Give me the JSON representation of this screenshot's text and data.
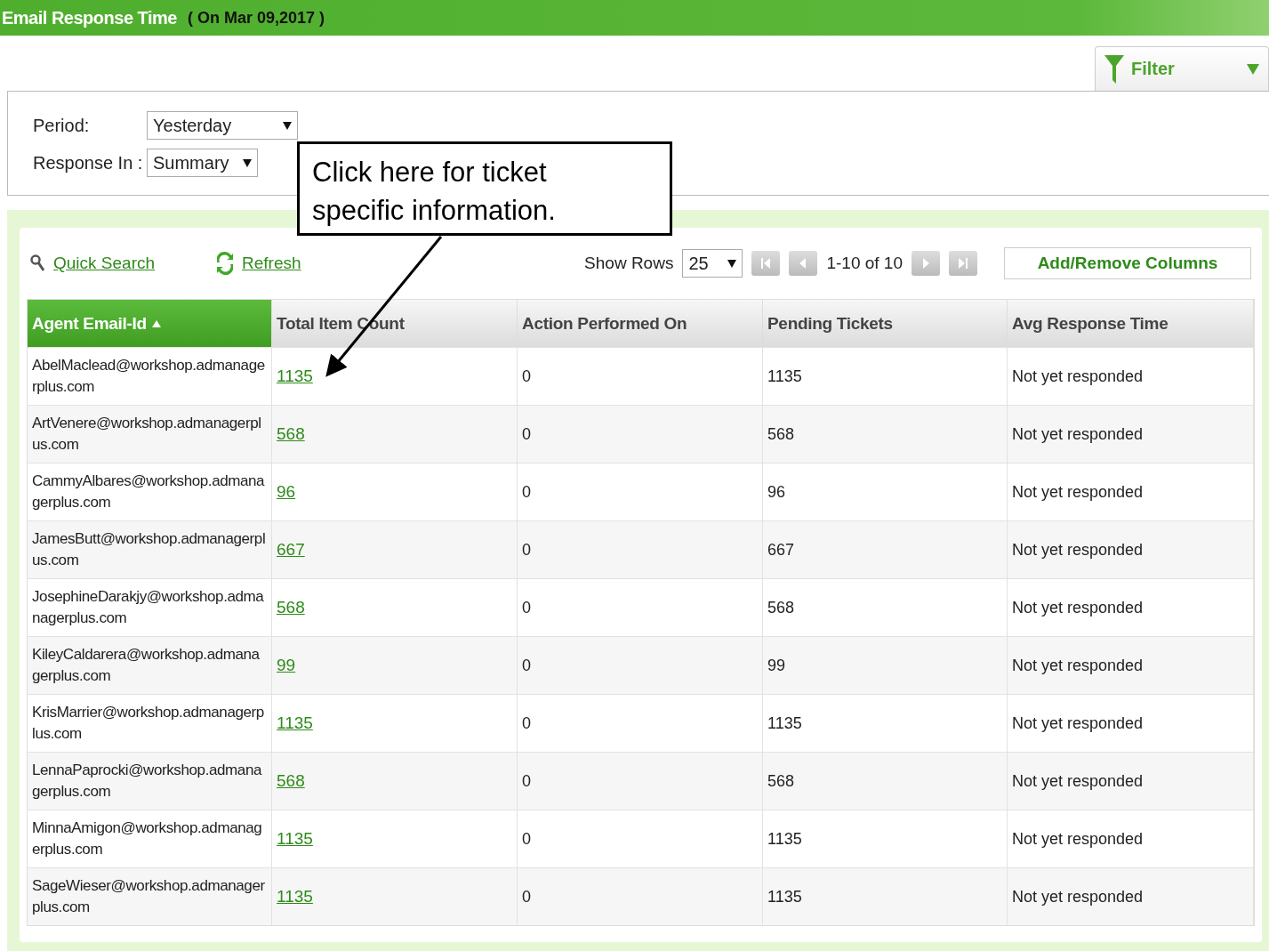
{
  "header": {
    "title": "Email Response Time",
    "date": "( On Mar 09,2017 )"
  },
  "filter_tab": {
    "label": "Filter"
  },
  "filters": [
    {
      "label": "Period:",
      "value": "Yesterday"
    },
    {
      "label": "Response In :",
      "value": "Summary"
    }
  ],
  "callout": {
    "text": "Click here for ticket specific information."
  },
  "toolbar": {
    "quick_search": "Quick Search",
    "refresh": "Refresh",
    "show_rows_label": "Show Rows",
    "show_rows_value": "25",
    "range": "1-10 of 10",
    "columns_button": "Add/Remove Columns"
  },
  "table": {
    "columns": [
      {
        "label": "Agent Email-Id",
        "sorted": true
      },
      {
        "label": "Total Item Count",
        "sorted": false
      },
      {
        "label": "Action Performed On",
        "sorted": false
      },
      {
        "label": "Pending Tickets",
        "sorted": false
      },
      {
        "label": "Avg Response Time",
        "sorted": false
      }
    ],
    "rows": [
      [
        "AbelMaclead@workshop.admanagerplus.com",
        "1135",
        "0",
        "1135",
        "Not yet responded"
      ],
      [
        "ArtVenere@workshop.admanagerplus.com",
        "568",
        "0",
        "568",
        "Not yet responded"
      ],
      [
        "CammyAlbares@workshop.admanagerplus.com",
        "96",
        "0",
        "96",
        "Not yet responded"
      ],
      [
        "JamesButt@workshop.admanagerplus.com",
        "667",
        "0",
        "667",
        "Not yet responded"
      ],
      [
        "JosephineDarakjy@workshop.admanagerplus.com",
        "568",
        "0",
        "568",
        "Not yet responded"
      ],
      [
        "KileyCaldarera@workshop.admanagerplus.com",
        "99",
        "0",
        "99",
        "Not yet responded"
      ],
      [
        "KrisMarrier@workshop.admanagerplus.com",
        "1135",
        "0",
        "1135",
        "Not yet responded"
      ],
      [
        "LennaPaprocki@workshop.admanagerplus.com",
        "568",
        "0",
        "568",
        "Not yet responded"
      ],
      [
        "MinnaAmigon@workshop.admanagerplus.com",
        "1135",
        "0",
        "1135",
        "Not yet responded"
      ],
      [
        "SageWieser@workshop.admanagerplus.com",
        "1135",
        "0",
        "1135",
        "Not yet responded"
      ]
    ]
  }
}
